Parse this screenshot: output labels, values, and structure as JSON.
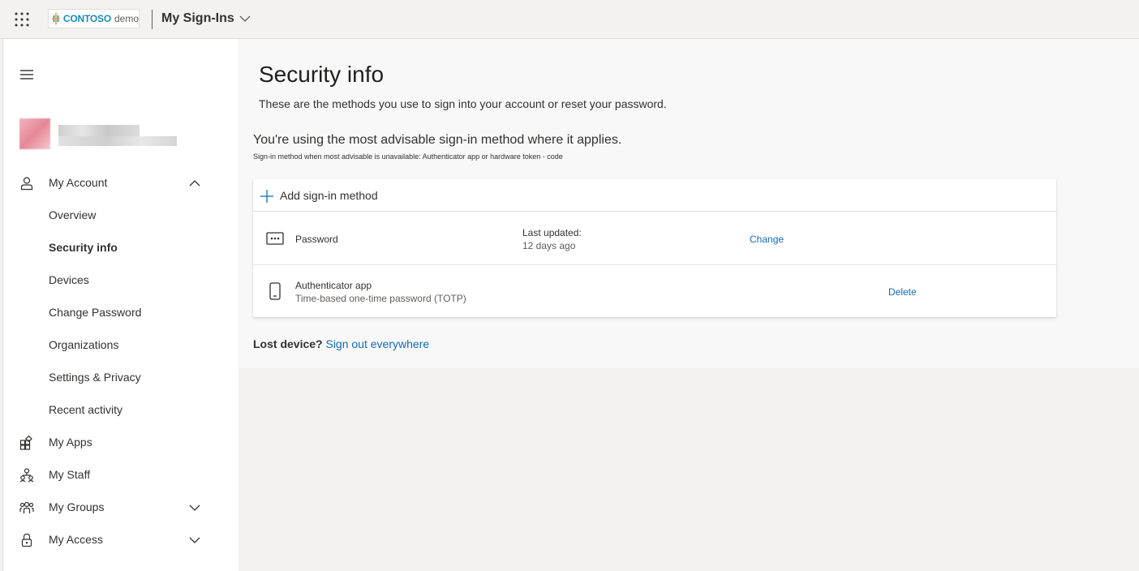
{
  "header": {
    "logo_brand": "CONTOSO",
    "logo_suffix": "demo",
    "app_title": "My Sign-Ins"
  },
  "sidebar": {
    "items": [
      {
        "label": "My Account",
        "icon": "person-icon",
        "expanded": true
      },
      {
        "label": "Overview"
      },
      {
        "label": "Security info",
        "active": true
      },
      {
        "label": "Devices"
      },
      {
        "label": "Change Password"
      },
      {
        "label": "Organizations"
      },
      {
        "label": "Settings & Privacy"
      },
      {
        "label": "Recent activity"
      },
      {
        "label": "My Apps",
        "icon": "apps-icon"
      },
      {
        "label": "My Staff",
        "icon": "staff-icon"
      },
      {
        "label": "My Groups",
        "icon": "groups-icon",
        "expanded": false
      },
      {
        "label": "My Access",
        "icon": "lock-icon",
        "expanded": false
      }
    ]
  },
  "main": {
    "title": "Security info",
    "description": "These are the methods you use to sign into your account or reset your password.",
    "advisable_heading": "You're using the most advisable sign-in method where it applies.",
    "advisable_detail": "Sign-in method when most advisable is unavailable: Authenticator app or hardware token - code",
    "add_method_label": "Add sign-in method",
    "methods": [
      {
        "name": "Password",
        "icon": "password-dots-icon",
        "updated_label": "Last updated:",
        "updated_value": "12 days ago",
        "action": "Change"
      },
      {
        "name": "Authenticator app",
        "icon": "phone-icon",
        "detail": "Time-based one-time password (TOTP)",
        "action": "Delete"
      }
    ],
    "lost_device_label": "Lost device?",
    "lost_device_link": "Sign out everywhere"
  },
  "colors": {
    "accent_link": "#0f6cbd",
    "brand": "#1a8ab8"
  }
}
